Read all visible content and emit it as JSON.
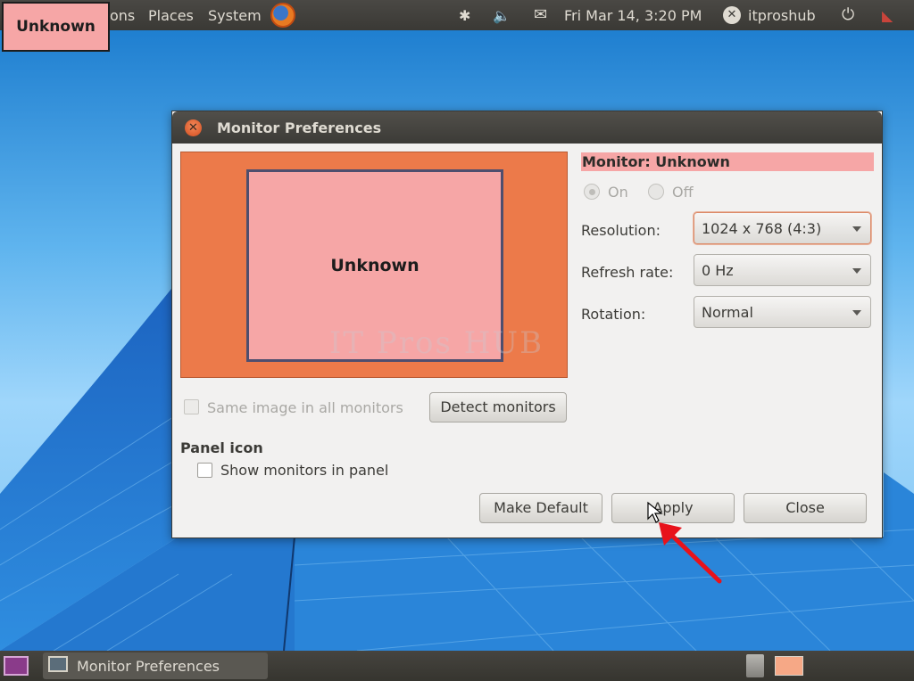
{
  "top_panel": {
    "badge": "Unknown",
    "menu": [
      "ons",
      "Places",
      "System"
    ],
    "datetime": "Fri Mar 14,  3:20 PM",
    "user": "itproshub"
  },
  "dialog": {
    "title": "Monitor Preferences",
    "monitor_box_label": "Unknown",
    "watermark": "IT Pros HUB",
    "monitor_heading": "Monitor: Unknown",
    "radio_on": "On",
    "radio_off": "Off",
    "resolution_label": "Resolution:",
    "resolution_value": "1024 x 768 (4:3)",
    "refresh_label": "Refresh rate:",
    "refresh_value": "0 Hz",
    "rotation_label": "Rotation:",
    "rotation_value": "Normal",
    "same_image_label": "Same image in all monitors",
    "detect_button": "Detect monitors",
    "panel_icon_heading": "Panel icon",
    "show_monitors_label": "Show monitors in panel",
    "make_default_button": "Make Default",
    "apply_button": "Apply",
    "close_button": "Close"
  },
  "bottom_panel": {
    "task_label": "Monitor Preferences"
  },
  "colors": {
    "panel": "#3c3b37",
    "monitor_area": "#ec7a4a",
    "monitor_box": "#f6a6a6",
    "arrow": "#e8121b"
  }
}
